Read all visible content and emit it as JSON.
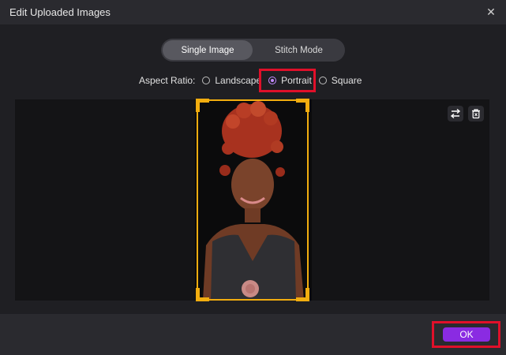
{
  "window": {
    "title": "Edit Uploaded Images"
  },
  "mode_tabs": [
    {
      "label": "Single Image",
      "active": true
    },
    {
      "label": "Stitch Mode",
      "active": false
    }
  ],
  "aspect_ratio": {
    "label": "Aspect Ratio:",
    "options": [
      {
        "label": "Landscape",
        "selected": false
      },
      {
        "label": "Portrait",
        "selected": true
      },
      {
        "label": "Square",
        "selected": false
      }
    ]
  },
  "toolbar": {
    "swap_icon": "swap-icon",
    "delete_icon": "trash-icon"
  },
  "footer": {
    "ok_label": "OK"
  },
  "colors": {
    "accent": "#8a2be2",
    "crop_frame": "#f2ad0f",
    "highlight": "#e0102a",
    "radio_selected": "#c48bff"
  }
}
